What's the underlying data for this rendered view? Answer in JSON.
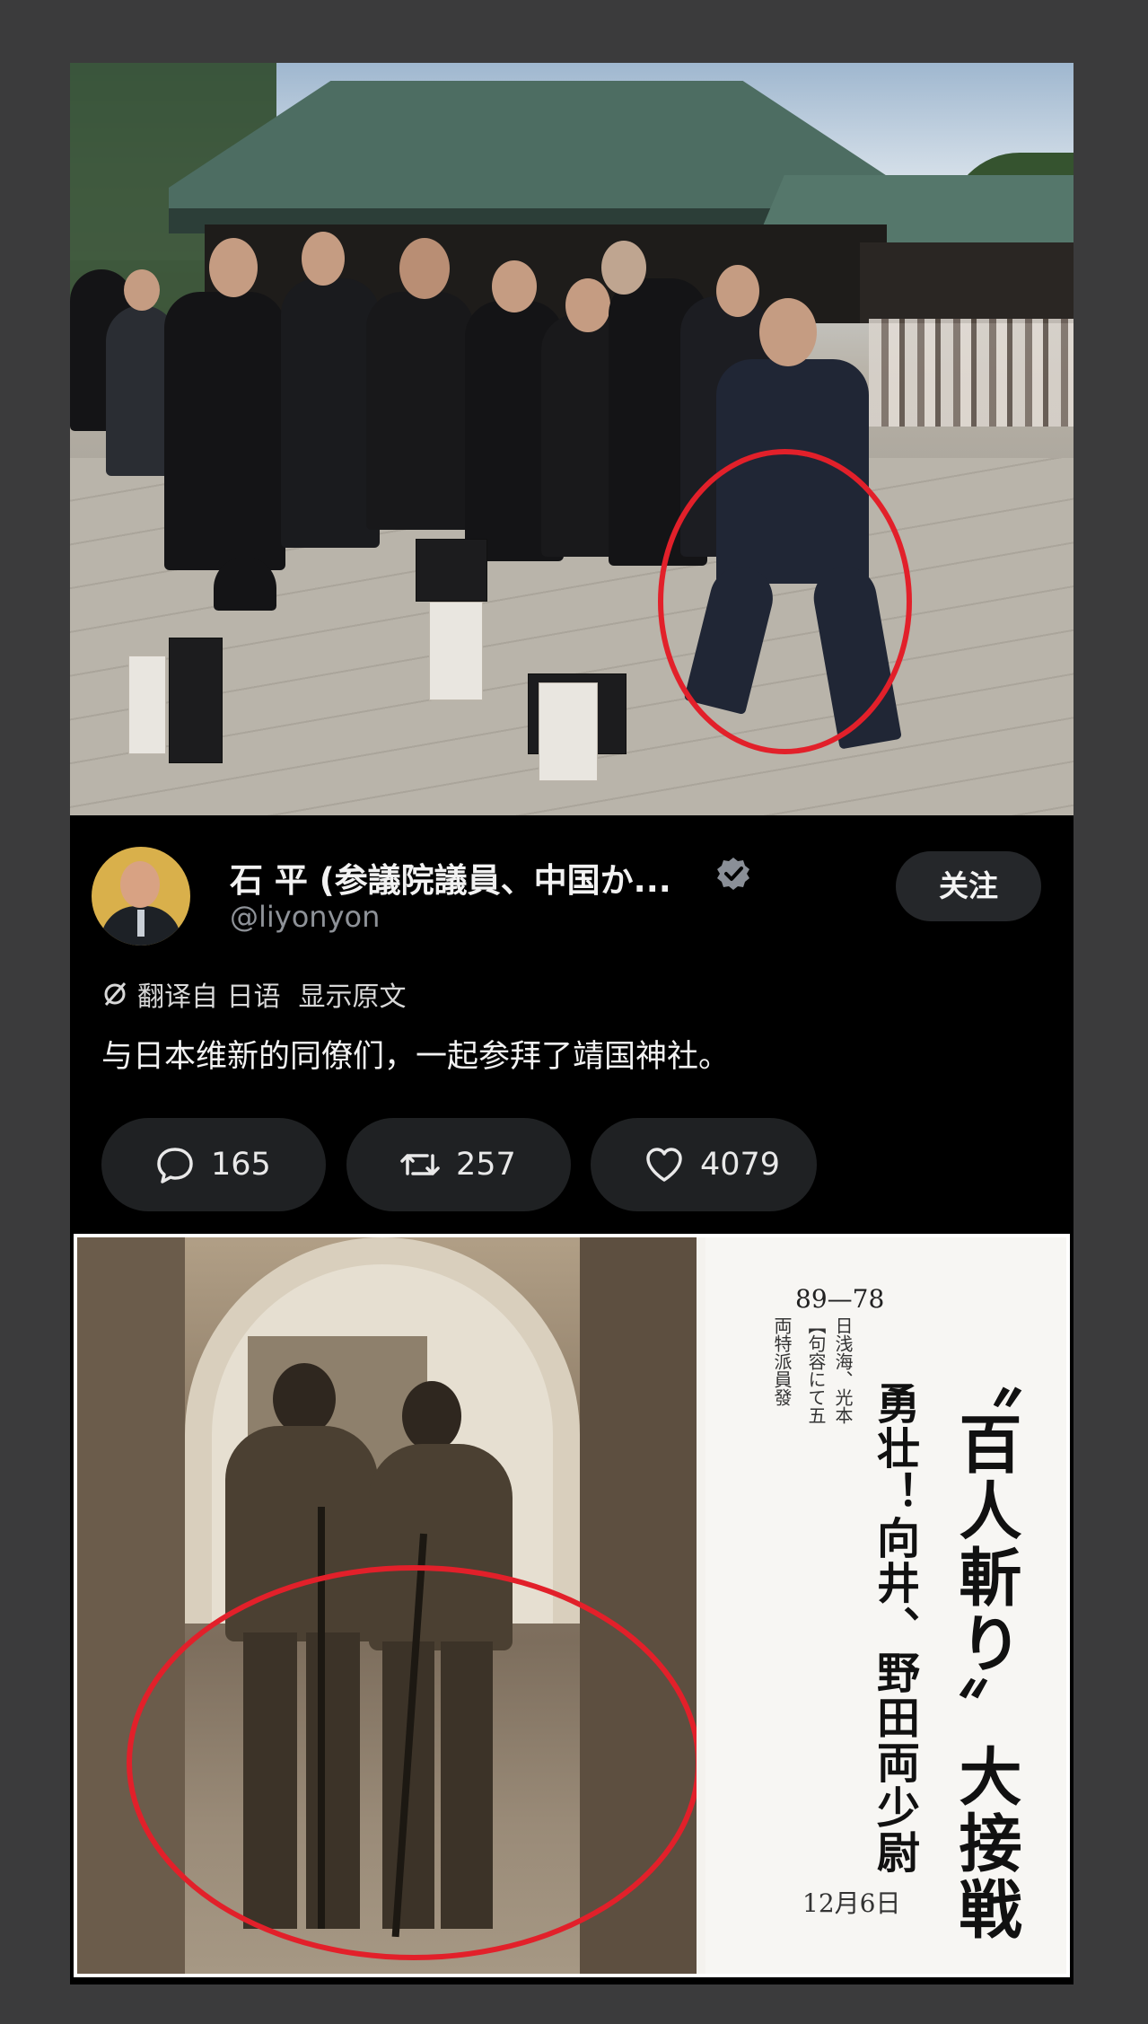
{
  "post": {
    "author_name": "石 平 (参議院議員、中国か...",
    "handle": "@liyonyon",
    "follow_label": "关注",
    "translate_from": "翻译自 日语",
    "show_original": "显示原文",
    "text": "与日本维新的同僚们，一起参拜了靖国神社。",
    "replies": "165",
    "reposts": "257",
    "likes": "4079"
  },
  "newspaper": {
    "title": "〝百人斬り〞大接戦",
    "subtitle": "勇壮！向井、野田両少尉",
    "score": "89—78",
    "col1": "両特派員發",
    "col2": "【句容にて五",
    "col3": "日浅海、光本",
    "date": "12月6日"
  },
  "colors": {
    "highlight_circle": "#e2202a",
    "card_bg": "#000000",
    "page_bg": "#3b3b3c"
  }
}
